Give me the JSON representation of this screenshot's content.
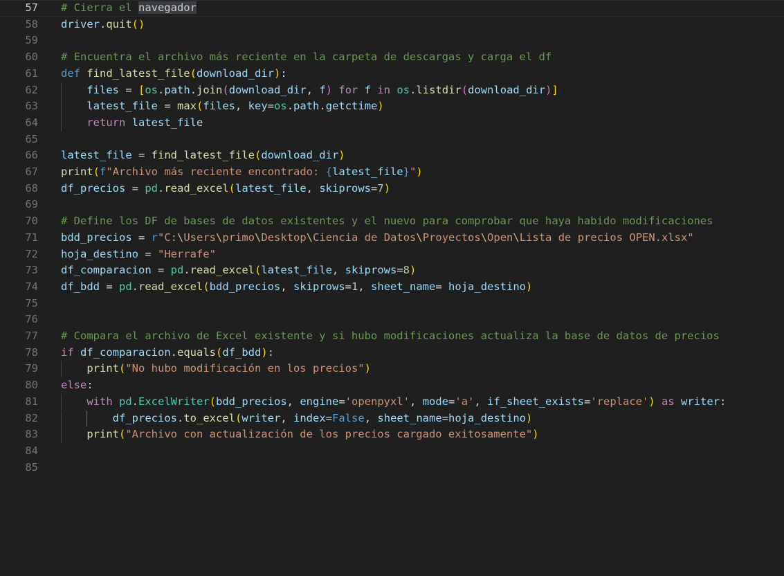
{
  "editor": {
    "colors": {
      "background": "#1f1f1f",
      "line_number": "#6e7681",
      "comment": "#6a9955",
      "keyword_def": "#569cd6",
      "keyword_control": "#c586c0",
      "function": "#dcdcaa",
      "variable": "#9cdcfe",
      "module": "#4ec9b0",
      "string": "#ce9178",
      "number": "#b5cea8",
      "bracket_level1": "#ffd700",
      "bracket_level2": "#da70d6",
      "bracket_level3": "#179fff"
    },
    "current_line": 57,
    "lines": [
      {
        "n": "57",
        "indent": 0,
        "tokens": [
          [
            "c",
            "# Cierra el "
          ],
          [
            "hl",
            "navegador"
          ]
        ]
      },
      {
        "n": "58",
        "indent": 0,
        "tokens": [
          [
            "v",
            "driver"
          ],
          [
            "p",
            "."
          ],
          [
            "f",
            "quit"
          ],
          [
            "b1",
            "()"
          ]
        ]
      },
      {
        "n": "59",
        "indent": 0,
        "tokens": []
      },
      {
        "n": "60",
        "indent": 0,
        "tokens": [
          [
            "c",
            "# Encuentra el archivo más reciente en la carpeta de descargas y carga el df"
          ]
        ]
      },
      {
        "n": "61",
        "indent": 0,
        "tokens": [
          [
            "k",
            "def "
          ],
          [
            "f",
            "find_latest_file"
          ],
          [
            "b1",
            "("
          ],
          [
            "v",
            "download_dir"
          ],
          [
            "b1",
            ")"
          ],
          [
            "p",
            ":"
          ]
        ]
      },
      {
        "n": "62",
        "indent": 1,
        "tokens": [
          [
            "v",
            "    files"
          ],
          [
            "o",
            " = "
          ],
          [
            "b1",
            "["
          ],
          [
            "m",
            "os"
          ],
          [
            "p",
            "."
          ],
          [
            "v",
            "path"
          ],
          [
            "p",
            "."
          ],
          [
            "f",
            "join"
          ],
          [
            "b2",
            "("
          ],
          [
            "v",
            "download_dir"
          ],
          [
            "p",
            ", "
          ],
          [
            "v",
            "f"
          ],
          [
            "b2",
            ")"
          ],
          [
            "kc",
            " for "
          ],
          [
            "v",
            "f"
          ],
          [
            "kc",
            " in "
          ],
          [
            "m",
            "os"
          ],
          [
            "p",
            "."
          ],
          [
            "f",
            "listdir"
          ],
          [
            "b2",
            "("
          ],
          [
            "v",
            "download_dir"
          ],
          [
            "b2",
            ")"
          ],
          [
            "b1",
            "]"
          ]
        ]
      },
      {
        "n": "63",
        "indent": 1,
        "tokens": [
          [
            "v",
            "    latest_file"
          ],
          [
            "o",
            " = "
          ],
          [
            "f",
            "max"
          ],
          [
            "b1",
            "("
          ],
          [
            "v",
            "files"
          ],
          [
            "p",
            ", "
          ],
          [
            "v",
            "key"
          ],
          [
            "o",
            "="
          ],
          [
            "m",
            "os"
          ],
          [
            "p",
            "."
          ],
          [
            "v",
            "path"
          ],
          [
            "p",
            "."
          ],
          [
            "v",
            "getctime"
          ],
          [
            "b1",
            ")"
          ]
        ]
      },
      {
        "n": "64",
        "indent": 1,
        "tokens": [
          [
            "kc",
            "    return "
          ],
          [
            "v",
            "latest_file"
          ]
        ]
      },
      {
        "n": "65",
        "indent": 0,
        "tokens": []
      },
      {
        "n": "66",
        "indent": 0,
        "tokens": [
          [
            "v",
            "latest_file"
          ],
          [
            "o",
            " = "
          ],
          [
            "f",
            "find_latest_file"
          ],
          [
            "b1",
            "("
          ],
          [
            "v",
            "download_dir"
          ],
          [
            "b1",
            ")"
          ]
        ]
      },
      {
        "n": "67",
        "indent": 0,
        "tokens": [
          [
            "f",
            "print"
          ],
          [
            "b1",
            "("
          ],
          [
            "k",
            "f"
          ],
          [
            "s",
            "\"Archivo más reciente encontrado: "
          ],
          [
            "k",
            "{"
          ],
          [
            "v",
            "latest_file"
          ],
          [
            "k",
            "}"
          ],
          [
            "s",
            "\""
          ],
          [
            "b1",
            ")"
          ]
        ]
      },
      {
        "n": "68",
        "indent": 0,
        "tokens": [
          [
            "v",
            "df_precios"
          ],
          [
            "o",
            " = "
          ],
          [
            "m",
            "pd"
          ],
          [
            "p",
            "."
          ],
          [
            "f",
            "read_excel"
          ],
          [
            "b1",
            "("
          ],
          [
            "v",
            "latest_file"
          ],
          [
            "p",
            ", "
          ],
          [
            "v",
            "skiprows"
          ],
          [
            "o",
            "="
          ],
          [
            "n",
            "7"
          ],
          [
            "b1",
            ")"
          ]
        ]
      },
      {
        "n": "69",
        "indent": 0,
        "tokens": []
      },
      {
        "n": "70",
        "indent": 0,
        "tokens": [
          [
            "c",
            "# Define los DF de bases de datos existentes y el nuevo para comprobar que haya habido modificaciones"
          ]
        ]
      },
      {
        "n": "71",
        "indent": 0,
        "tokens": [
          [
            "v",
            "bdd_precios"
          ],
          [
            "o",
            " = "
          ],
          [
            "k",
            "r"
          ],
          [
            "s",
            "\"C:"
          ],
          [
            "e",
            "\\"
          ],
          [
            "s",
            "Users"
          ],
          [
            "e",
            "\\"
          ],
          [
            "s",
            "primo"
          ],
          [
            "e",
            "\\"
          ],
          [
            "s",
            "Desktop"
          ],
          [
            "e",
            "\\"
          ],
          [
            "s",
            "Ciencia de Datos"
          ],
          [
            "e",
            "\\"
          ],
          [
            "s",
            "Proyectos"
          ],
          [
            "e",
            "\\"
          ],
          [
            "s",
            "Open"
          ],
          [
            "e",
            "\\"
          ],
          [
            "s",
            "Lista de precios OPEN.xlsx\""
          ]
        ]
      },
      {
        "n": "72",
        "indent": 0,
        "tokens": [
          [
            "v",
            "hoja_destino"
          ],
          [
            "o",
            " = "
          ],
          [
            "s",
            "\"Herrafe\""
          ]
        ]
      },
      {
        "n": "73",
        "indent": 0,
        "tokens": [
          [
            "v",
            "df_comparacion"
          ],
          [
            "o",
            " = "
          ],
          [
            "m",
            "pd"
          ],
          [
            "p",
            "."
          ],
          [
            "f",
            "read_excel"
          ],
          [
            "b1",
            "("
          ],
          [
            "v",
            "latest_file"
          ],
          [
            "p",
            ", "
          ],
          [
            "v",
            "skiprows"
          ],
          [
            "o",
            "="
          ],
          [
            "n",
            "8"
          ],
          [
            "b1",
            ")"
          ]
        ]
      },
      {
        "n": "74",
        "indent": 0,
        "tokens": [
          [
            "v",
            "df_bdd"
          ],
          [
            "o",
            " = "
          ],
          [
            "m",
            "pd"
          ],
          [
            "p",
            "."
          ],
          [
            "f",
            "read_excel"
          ],
          [
            "b1",
            "("
          ],
          [
            "v",
            "bdd_precios"
          ],
          [
            "p",
            ", "
          ],
          [
            "v",
            "skiprows"
          ],
          [
            "o",
            "="
          ],
          [
            "n",
            "1"
          ],
          [
            "p",
            ", "
          ],
          [
            "v",
            "sheet_name"
          ],
          [
            "o",
            "= "
          ],
          [
            "v",
            "hoja_destino"
          ],
          [
            "b1",
            ")"
          ]
        ]
      },
      {
        "n": "75",
        "indent": 0,
        "tokens": []
      },
      {
        "n": "76",
        "indent": 0,
        "tokens": []
      },
      {
        "n": "77",
        "indent": 0,
        "tokens": [
          [
            "c",
            "# Compara el archivo de Excel existente y si hubo modificaciones actualiza la base de datos de precios"
          ]
        ]
      },
      {
        "n": "78",
        "indent": 0,
        "tokens": [
          [
            "kc",
            "if "
          ],
          [
            "v",
            "df_comparacion"
          ],
          [
            "p",
            "."
          ],
          [
            "f",
            "equals"
          ],
          [
            "b1",
            "("
          ],
          [
            "v",
            "df_bdd"
          ],
          [
            "b1",
            ")"
          ],
          [
            "p",
            ":"
          ]
        ]
      },
      {
        "n": "79",
        "indent": 1,
        "tokens": [
          [
            "f",
            "    print"
          ],
          [
            "b1",
            "("
          ],
          [
            "s",
            "\"No hubo modificación en los precios\""
          ],
          [
            "b1",
            ")"
          ]
        ]
      },
      {
        "n": "80",
        "indent": 0,
        "tokens": [
          [
            "kc",
            "else"
          ],
          [
            "p",
            ":"
          ]
        ]
      },
      {
        "n": "81",
        "indent": 1,
        "tokens": [
          [
            "kc",
            "    with "
          ],
          [
            "m",
            "pd"
          ],
          [
            "p",
            "."
          ],
          [
            "m",
            "ExcelWriter"
          ],
          [
            "b1",
            "("
          ],
          [
            "v",
            "bdd_precios"
          ],
          [
            "p",
            ", "
          ],
          [
            "v",
            "engine"
          ],
          [
            "o",
            "="
          ],
          [
            "s",
            "'openpyxl'"
          ],
          [
            "p",
            ", "
          ],
          [
            "v",
            "mode"
          ],
          [
            "o",
            "="
          ],
          [
            "s",
            "'a'"
          ],
          [
            "p",
            ", "
          ],
          [
            "v",
            "if_sheet_exists"
          ],
          [
            "o",
            "="
          ],
          [
            "s",
            "'replace'"
          ],
          [
            "b1",
            ")"
          ],
          [
            "kc",
            " as "
          ],
          [
            "v",
            "writer"
          ],
          [
            "p",
            ":"
          ]
        ]
      },
      {
        "n": "82",
        "indent": 2,
        "tokens": [
          [
            "v",
            "        df_precios"
          ],
          [
            "p",
            "."
          ],
          [
            "f",
            "to_excel"
          ],
          [
            "b1",
            "("
          ],
          [
            "v",
            "writer"
          ],
          [
            "p",
            ", "
          ],
          [
            "v",
            "index"
          ],
          [
            "o",
            "="
          ],
          [
            "k",
            "False"
          ],
          [
            "p",
            ", "
          ],
          [
            "v",
            "sheet_name"
          ],
          [
            "o",
            "="
          ],
          [
            "v",
            "hoja_destino"
          ],
          [
            "b1",
            ")"
          ]
        ]
      },
      {
        "n": "83",
        "indent": 1,
        "tokens": [
          [
            "f",
            "    print"
          ],
          [
            "b1",
            "("
          ],
          [
            "s",
            "\"Archivo con actualización de los precios cargado exitosamente\""
          ],
          [
            "b1",
            ")"
          ]
        ]
      },
      {
        "n": "84",
        "indent": 0,
        "tokens": []
      },
      {
        "n": "85",
        "indent": 0,
        "tokens": []
      }
    ]
  }
}
